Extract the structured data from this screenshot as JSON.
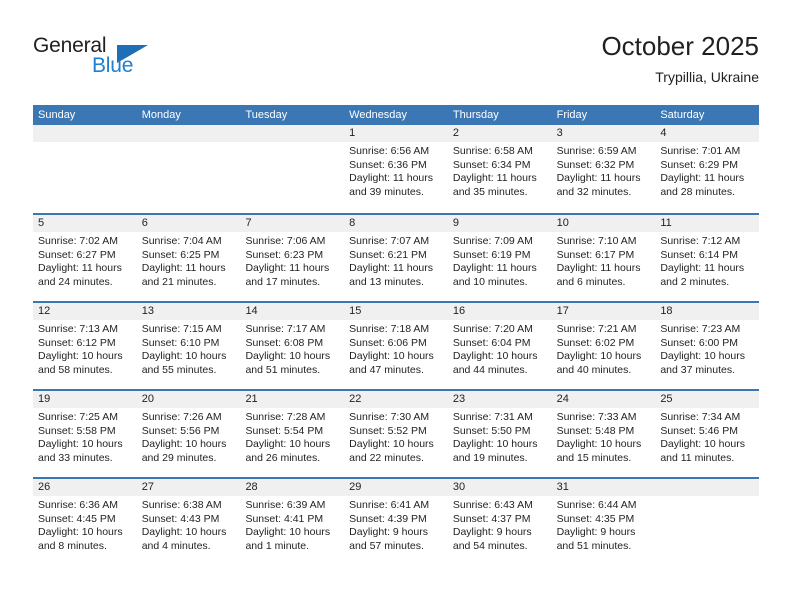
{
  "brand": {
    "name_part1": "General",
    "name_part2": "Blue",
    "triangle_color": "#1f6fb5",
    "blue_color": "#1f7fd0"
  },
  "header": {
    "title": "October 2025",
    "location": "Trypillia, Ukraine"
  },
  "theme": {
    "header_bg": "#3b77b5",
    "header_text": "#ffffff",
    "daynum_bg": "#f0f0f0",
    "cell_bg": "#ffffff",
    "text": "#231f20"
  },
  "weekday_headers": [
    "Sunday",
    "Monday",
    "Tuesday",
    "Wednesday",
    "Thursday",
    "Friday",
    "Saturday"
  ],
  "weeks": [
    [
      {
        "empty": true
      },
      {
        "empty": true
      },
      {
        "empty": true
      },
      {
        "day": "1",
        "sunrise": "Sunrise: 6:56 AM",
        "sunset": "Sunset: 6:36 PM",
        "daylight1": "Daylight: 11 hours",
        "daylight2": "and 39 minutes."
      },
      {
        "day": "2",
        "sunrise": "Sunrise: 6:58 AM",
        "sunset": "Sunset: 6:34 PM",
        "daylight1": "Daylight: 11 hours",
        "daylight2": "and 35 minutes."
      },
      {
        "day": "3",
        "sunrise": "Sunrise: 6:59 AM",
        "sunset": "Sunset: 6:32 PM",
        "daylight1": "Daylight: 11 hours",
        "daylight2": "and 32 minutes."
      },
      {
        "day": "4",
        "sunrise": "Sunrise: 7:01 AM",
        "sunset": "Sunset: 6:29 PM",
        "daylight1": "Daylight: 11 hours",
        "daylight2": "and 28 minutes."
      }
    ],
    [
      {
        "day": "5",
        "sunrise": "Sunrise: 7:02 AM",
        "sunset": "Sunset: 6:27 PM",
        "daylight1": "Daylight: 11 hours",
        "daylight2": "and 24 minutes."
      },
      {
        "day": "6",
        "sunrise": "Sunrise: 7:04 AM",
        "sunset": "Sunset: 6:25 PM",
        "daylight1": "Daylight: 11 hours",
        "daylight2": "and 21 minutes."
      },
      {
        "day": "7",
        "sunrise": "Sunrise: 7:06 AM",
        "sunset": "Sunset: 6:23 PM",
        "daylight1": "Daylight: 11 hours",
        "daylight2": "and 17 minutes."
      },
      {
        "day": "8",
        "sunrise": "Sunrise: 7:07 AM",
        "sunset": "Sunset: 6:21 PM",
        "daylight1": "Daylight: 11 hours",
        "daylight2": "and 13 minutes."
      },
      {
        "day": "9",
        "sunrise": "Sunrise: 7:09 AM",
        "sunset": "Sunset: 6:19 PM",
        "daylight1": "Daylight: 11 hours",
        "daylight2": "and 10 minutes."
      },
      {
        "day": "10",
        "sunrise": "Sunrise: 7:10 AM",
        "sunset": "Sunset: 6:17 PM",
        "daylight1": "Daylight: 11 hours",
        "daylight2": "and 6 minutes."
      },
      {
        "day": "11",
        "sunrise": "Sunrise: 7:12 AM",
        "sunset": "Sunset: 6:14 PM",
        "daylight1": "Daylight: 11 hours",
        "daylight2": "and 2 minutes."
      }
    ],
    [
      {
        "day": "12",
        "sunrise": "Sunrise: 7:13 AM",
        "sunset": "Sunset: 6:12 PM",
        "daylight1": "Daylight: 10 hours",
        "daylight2": "and 58 minutes."
      },
      {
        "day": "13",
        "sunrise": "Sunrise: 7:15 AM",
        "sunset": "Sunset: 6:10 PM",
        "daylight1": "Daylight: 10 hours",
        "daylight2": "and 55 minutes."
      },
      {
        "day": "14",
        "sunrise": "Sunrise: 7:17 AM",
        "sunset": "Sunset: 6:08 PM",
        "daylight1": "Daylight: 10 hours",
        "daylight2": "and 51 minutes."
      },
      {
        "day": "15",
        "sunrise": "Sunrise: 7:18 AM",
        "sunset": "Sunset: 6:06 PM",
        "daylight1": "Daylight: 10 hours",
        "daylight2": "and 47 minutes."
      },
      {
        "day": "16",
        "sunrise": "Sunrise: 7:20 AM",
        "sunset": "Sunset: 6:04 PM",
        "daylight1": "Daylight: 10 hours",
        "daylight2": "and 44 minutes."
      },
      {
        "day": "17",
        "sunrise": "Sunrise: 7:21 AM",
        "sunset": "Sunset: 6:02 PM",
        "daylight1": "Daylight: 10 hours",
        "daylight2": "and 40 minutes."
      },
      {
        "day": "18",
        "sunrise": "Sunrise: 7:23 AM",
        "sunset": "Sunset: 6:00 PM",
        "daylight1": "Daylight: 10 hours",
        "daylight2": "and 37 minutes."
      }
    ],
    [
      {
        "day": "19",
        "sunrise": "Sunrise: 7:25 AM",
        "sunset": "Sunset: 5:58 PM",
        "daylight1": "Daylight: 10 hours",
        "daylight2": "and 33 minutes."
      },
      {
        "day": "20",
        "sunrise": "Sunrise: 7:26 AM",
        "sunset": "Sunset: 5:56 PM",
        "daylight1": "Daylight: 10 hours",
        "daylight2": "and 29 minutes."
      },
      {
        "day": "21",
        "sunrise": "Sunrise: 7:28 AM",
        "sunset": "Sunset: 5:54 PM",
        "daylight1": "Daylight: 10 hours",
        "daylight2": "and 26 minutes."
      },
      {
        "day": "22",
        "sunrise": "Sunrise: 7:30 AM",
        "sunset": "Sunset: 5:52 PM",
        "daylight1": "Daylight: 10 hours",
        "daylight2": "and 22 minutes."
      },
      {
        "day": "23",
        "sunrise": "Sunrise: 7:31 AM",
        "sunset": "Sunset: 5:50 PM",
        "daylight1": "Daylight: 10 hours",
        "daylight2": "and 19 minutes."
      },
      {
        "day": "24",
        "sunrise": "Sunrise: 7:33 AM",
        "sunset": "Sunset: 5:48 PM",
        "daylight1": "Daylight: 10 hours",
        "daylight2": "and 15 minutes."
      },
      {
        "day": "25",
        "sunrise": "Sunrise: 7:34 AM",
        "sunset": "Sunset: 5:46 PM",
        "daylight1": "Daylight: 10 hours",
        "daylight2": "and 11 minutes."
      }
    ],
    [
      {
        "day": "26",
        "sunrise": "Sunrise: 6:36 AM",
        "sunset": "Sunset: 4:45 PM",
        "daylight1": "Daylight: 10 hours",
        "daylight2": "and 8 minutes."
      },
      {
        "day": "27",
        "sunrise": "Sunrise: 6:38 AM",
        "sunset": "Sunset: 4:43 PM",
        "daylight1": "Daylight: 10 hours",
        "daylight2": "and 4 minutes."
      },
      {
        "day": "28",
        "sunrise": "Sunrise: 6:39 AM",
        "sunset": "Sunset: 4:41 PM",
        "daylight1": "Daylight: 10 hours",
        "daylight2": "and 1 minute."
      },
      {
        "day": "29",
        "sunrise": "Sunrise: 6:41 AM",
        "sunset": "Sunset: 4:39 PM",
        "daylight1": "Daylight: 9 hours",
        "daylight2": "and 57 minutes."
      },
      {
        "day": "30",
        "sunrise": "Sunrise: 6:43 AM",
        "sunset": "Sunset: 4:37 PM",
        "daylight1": "Daylight: 9 hours",
        "daylight2": "and 54 minutes."
      },
      {
        "day": "31",
        "sunrise": "Sunrise: 6:44 AM",
        "sunset": "Sunset: 4:35 PM",
        "daylight1": "Daylight: 9 hours",
        "daylight2": "and 51 minutes."
      },
      {
        "empty": true
      }
    ]
  ]
}
